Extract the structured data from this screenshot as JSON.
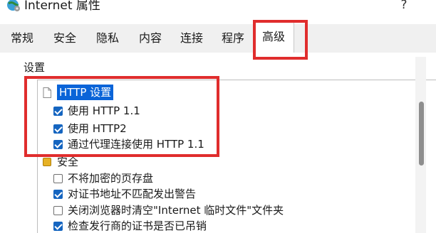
{
  "window": {
    "title": "Internet 属性",
    "help_glyph": "?",
    "app_icon": "globe-gear-icon"
  },
  "tabs": [
    {
      "label": "常规",
      "active": false
    },
    {
      "label": "安全",
      "active": false
    },
    {
      "label": "隐私",
      "active": false
    },
    {
      "label": "内容",
      "active": false
    },
    {
      "label": "连接",
      "active": false
    },
    {
      "label": "程序",
      "active": false
    },
    {
      "label": "高级",
      "active": true
    }
  ],
  "settings": {
    "label": "设置",
    "tree": [
      {
        "type": "category",
        "icon": "page-icon",
        "label": "HTTP 设置",
        "selected": true
      },
      {
        "type": "checkbox",
        "label": "使用 HTTP 1.1",
        "checked": true
      },
      {
        "type": "checkbox",
        "label": "使用 HTTP2",
        "checked": true
      },
      {
        "type": "checkbox",
        "label": "通过代理连接使用 HTTP 1.1",
        "checked": true
      },
      {
        "type": "category",
        "icon": "lock-icon",
        "label": "安全",
        "selected": false
      },
      {
        "type": "checkbox",
        "label": "不将加密的页存盘",
        "checked": false
      },
      {
        "type": "checkbox",
        "label": "对证书地址不匹配发出警告",
        "checked": true
      },
      {
        "type": "checkbox",
        "label": "关闭浏览器时清空\"Internet 临时文件\"文件夹",
        "checked": false
      },
      {
        "type": "checkbox",
        "label": "检查发行商的证书是否已吊销",
        "checked": true
      }
    ]
  },
  "colors": {
    "annotation": "#e02d2d",
    "checkbox_checked": "#1565c0",
    "selection": "#0a64d8",
    "tab_strip": "#f0f0f0"
  }
}
